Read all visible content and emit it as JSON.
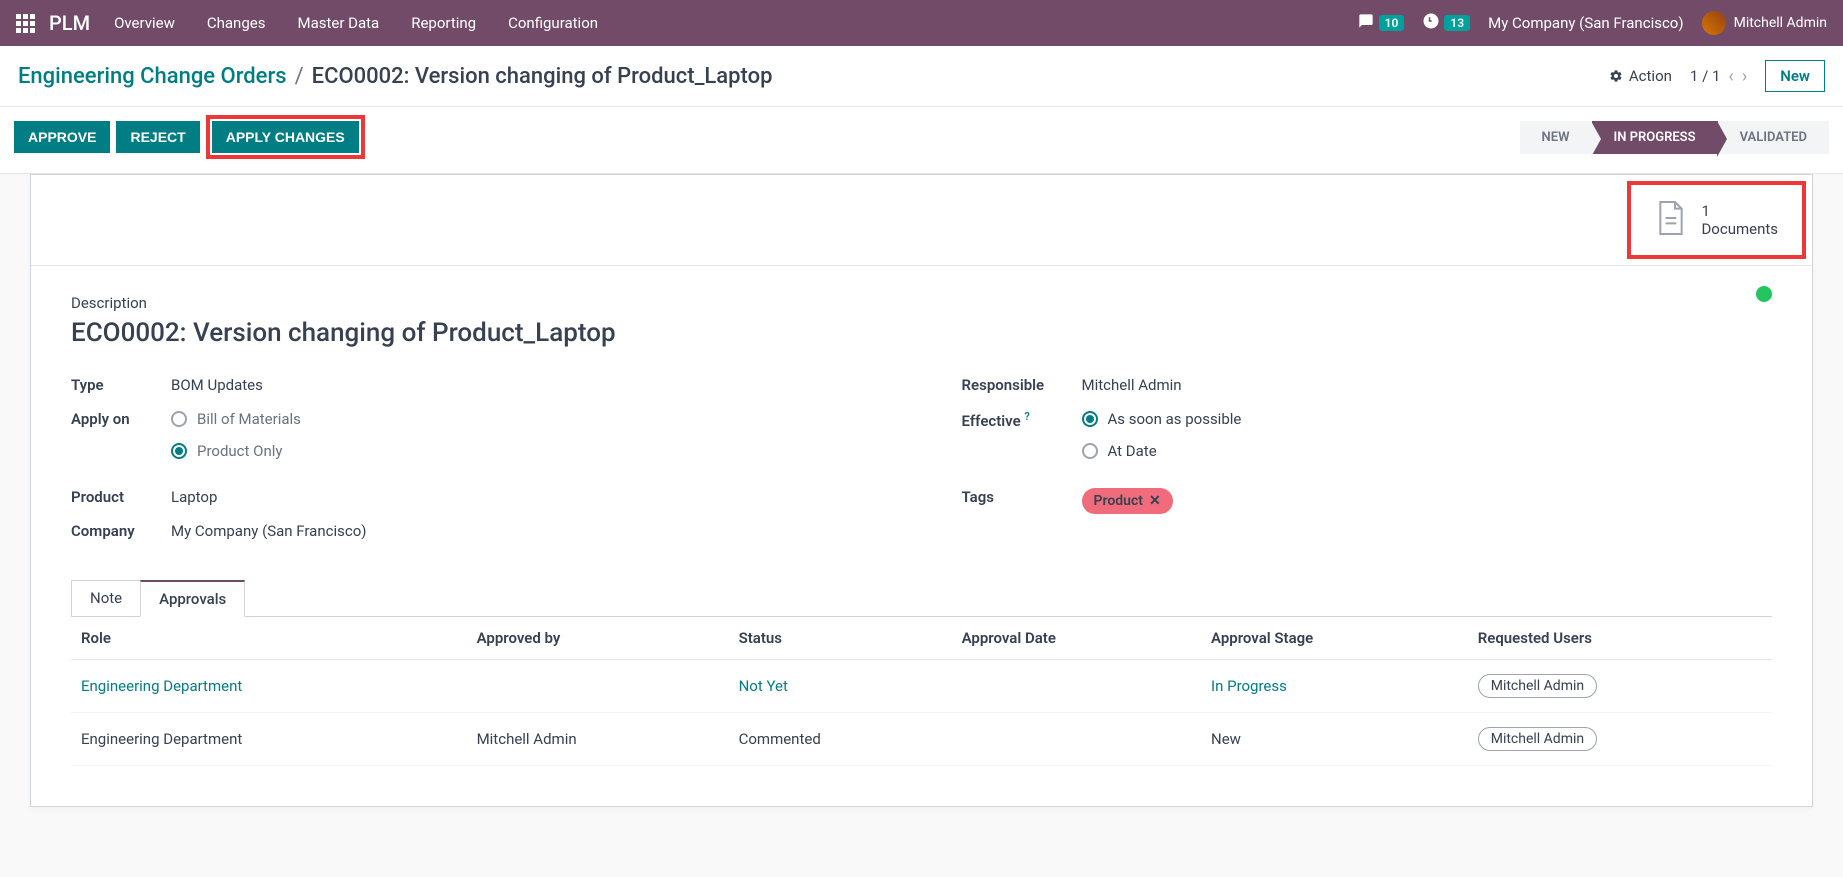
{
  "navbar": {
    "brand": "PLM",
    "menu": [
      "Overview",
      "Changes",
      "Master Data",
      "Reporting",
      "Configuration"
    ],
    "chat_count": "10",
    "activity_count": "13",
    "company": "My Company (San Francisco)",
    "user": "Mitchell Admin"
  },
  "breadcrumb": {
    "parent": "Engineering Change Orders",
    "current": "ECO0002: Version changing of Product_Laptop",
    "action_label": "Action",
    "pager": "1 / 1",
    "new_label": "New"
  },
  "actions": {
    "approve": "APPROVE",
    "reject": "REJECT",
    "apply": "APPLY CHANGES"
  },
  "status_steps": {
    "new": "NEW",
    "in_progress": "IN PROGRESS",
    "validated": "VALIDATED"
  },
  "documents": {
    "count": "1",
    "label": "Documents"
  },
  "form": {
    "desc_label": "Description",
    "title": "ECO0002: Version changing of Product_Laptop",
    "type_label": "Type",
    "type_value": "BOM Updates",
    "apply_on_label": "Apply on",
    "apply_opt_bom": "Bill of Materials",
    "apply_opt_product": "Product Only",
    "product_label": "Product",
    "product_value": "Laptop",
    "company_label": "Company",
    "company_value": "My Company (San Francisco)",
    "responsible_label": "Responsible",
    "responsible_value": "Mitchell Admin",
    "effective_label": "Effective",
    "effective_asap": "As soon as possible",
    "effective_at_date": "At Date",
    "tags_label": "Tags",
    "tag_product": "Product"
  },
  "tabs": {
    "note": "Note",
    "approvals": "Approvals"
  },
  "table": {
    "headers": {
      "role": "Role",
      "approved_by": "Approved by",
      "status": "Status",
      "approval_date": "Approval Date",
      "approval_stage": "Approval Stage",
      "requested_users": "Requested Users"
    },
    "rows": [
      {
        "role": "Engineering Department",
        "approved_by": "",
        "status": "Not Yet",
        "approval_date": "",
        "stage": "In Progress",
        "user": "Mitchell Admin",
        "link": true
      },
      {
        "role": "Engineering Department",
        "approved_by": "Mitchell Admin",
        "status": "Commented",
        "approval_date": "",
        "stage": "New",
        "user": "Mitchell Admin",
        "link": false
      }
    ]
  }
}
